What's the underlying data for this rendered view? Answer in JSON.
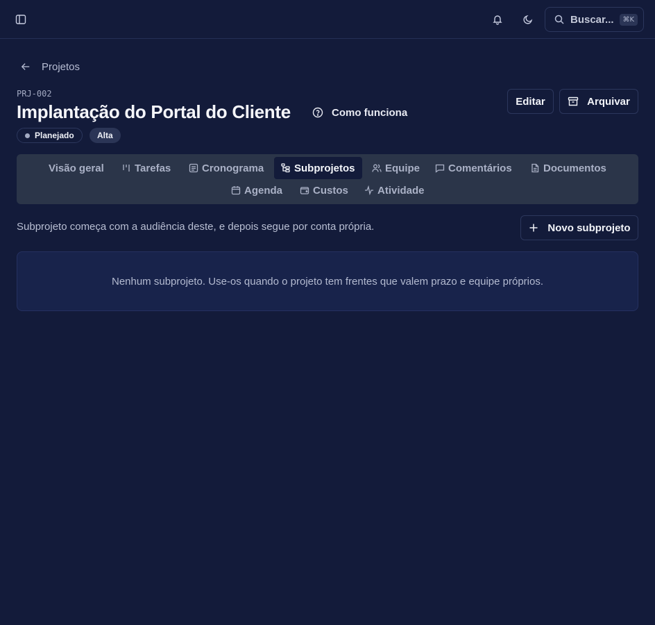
{
  "topbar": {
    "icons": [
      "sidebar-toggle-icon",
      "bell-icon",
      "moon-icon",
      "search-icon"
    ],
    "search": {
      "placeholder": "Buscar...",
      "shortcut": "⌘K"
    }
  },
  "breadcrumb": {
    "back_label": "Projetos"
  },
  "project": {
    "code": "PRJ-002",
    "title": "Implantação do Portal do Cliente",
    "help_label": "Como funciona",
    "status": "Planejado",
    "priority": "Alta"
  },
  "actions": {
    "edit_label": "Editar",
    "archive_label": "Arquivar"
  },
  "tabs": [
    {
      "label": "Visão geral",
      "icon": ""
    },
    {
      "label": "Tarefas",
      "icon": "kanban-icon"
    },
    {
      "label": "Cronograma",
      "icon": "list-icon"
    },
    {
      "label": "Subprojetos",
      "icon": "tree-icon",
      "active": true
    },
    {
      "label": "Equipe",
      "icon": "users-icon"
    },
    {
      "label": "Comentários",
      "icon": "message-icon"
    },
    {
      "label": "Documentos",
      "icon": "file-icon"
    },
    {
      "label": "Agenda",
      "icon": "calendar-icon"
    },
    {
      "label": "Custos",
      "icon": "wallet-icon"
    },
    {
      "label": "Atividade",
      "icon": "activity-icon"
    }
  ],
  "subprojects": {
    "description": "Subprojeto começa com a audiência deste, e depois segue por conta própria.",
    "new_button_label": "Novo subprojeto",
    "empty_message": "Nenhum subprojeto. Use-os quando o projeto tem frentes que valem prazo e equipe próprios."
  },
  "colors": {
    "background": "#131b3a",
    "tabs_background": "#2b3549",
    "empty_background": "#18234b",
    "border": "#2c375d"
  }
}
